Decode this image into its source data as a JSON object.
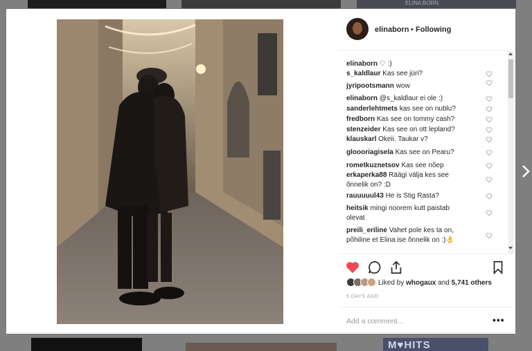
{
  "background": {
    "bottom_right_label": "M♥HITS",
    "top_right_label": "ELINA BORN"
  },
  "post": {
    "username": "elinaborn",
    "follow_separator": "•",
    "follow_status": "Following"
  },
  "comments": [
    {
      "user": "elinaborn",
      "text": "♡ :)"
    },
    {
      "user": "s_kaldlaur",
      "text": "Kas see jüri?"
    },
    {
      "user": "jyripootsmann",
      "text": "wow"
    },
    {
      "user": "elinaborn",
      "text": "@s_kaldlaur ei ole :)"
    },
    {
      "user": "sanderlehtmets",
      "text": "kas see on nublu?"
    },
    {
      "user": "fredborn",
      "text": "Kas see on tommy cash?"
    },
    {
      "user": "stenzeider",
      "text": "Kas see on ott lepland?"
    },
    {
      "user": "klauskarl",
      "text": "Okeii. Taukar v?"
    },
    {
      "user": "gloooriagisela",
      "text": "Kas see on Pearu?"
    },
    {
      "user": "rometkuznetsov",
      "text": "Kas see nõep"
    },
    {
      "user": "erkaperka88",
      "text": "Räägi välja kes see õnnelik on? :D"
    },
    {
      "user": "rauuuuul43",
      "text": "He is Stig Rasta?"
    },
    {
      "user": "heitsik",
      "text": "mingi noorem kutt paistab olevat"
    },
    {
      "user": "preili_eriline",
      "text": "Vahet pole kes ta on, põhiline et Elina ise õnnelik on :)👌"
    }
  ],
  "likes": {
    "prefix": "Liked by",
    "user": "whogaux",
    "and": "and",
    "count": "5,741 others"
  },
  "timestamp": "5 DAYS AGO",
  "add_comment_placeholder": "Add a comment...",
  "more_label": "•••",
  "colors": {
    "heart_liked": "#ed4956",
    "text_primary": "#262626",
    "text_muted": "#999999"
  },
  "icons": [
    "heart-icon",
    "comment-icon",
    "share-icon",
    "bookmark-icon",
    "chevron-right-icon"
  ]
}
